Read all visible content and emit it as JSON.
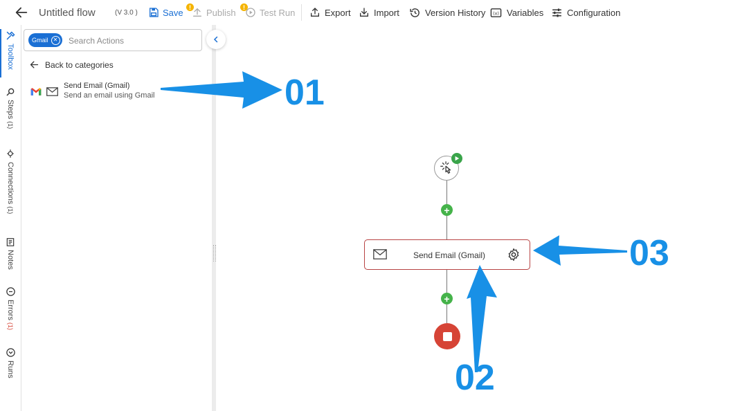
{
  "header": {
    "flow_title": "Untitled flow",
    "version": "(V 3.0 )",
    "save_label": "Save",
    "publish_label": "Publish",
    "testrun_label": "Test Run",
    "export_label": "Export",
    "import_label": "Import",
    "version_history_label": "Version History",
    "variables_label": "Variables",
    "configuration_label": "Configuration",
    "warning_badge": "!"
  },
  "rail": {
    "items": [
      {
        "label": "Toolbox",
        "count": "",
        "icon": "toolbox-icon"
      },
      {
        "label": "Steps",
        "count": "(1)",
        "icon": "search-icon"
      },
      {
        "label": "Connections",
        "count": "(1)",
        "icon": "plug-icon"
      },
      {
        "label": "Notes",
        "count": "",
        "icon": "notes-icon"
      },
      {
        "label": "Errors",
        "count": "(1)",
        "icon": "error-icon"
      },
      {
        "label": "Runs",
        "count": "",
        "icon": "runs-icon"
      }
    ]
  },
  "panel": {
    "chip_label": "Gmail",
    "search_placeholder": "Search Actions",
    "back_label": "Back to categories",
    "action_title": "Send Email (Gmail)",
    "action_desc": "Send an email using Gmail"
  },
  "canvas": {
    "step_label": "Send Email (Gmail)",
    "plus": "+"
  },
  "callouts": {
    "c1": "01",
    "c2": "02",
    "c3": "03"
  },
  "colors": {
    "accent": "#1a6fd4",
    "callout": "#1890e6",
    "add": "#45b34a",
    "stop": "#d64436",
    "step_border": "#b74242",
    "warning": "#f5b400"
  }
}
